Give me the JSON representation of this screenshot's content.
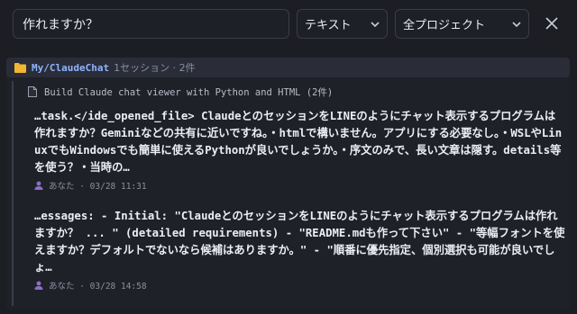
{
  "search": {
    "value": "作れますか？"
  },
  "filters": {
    "type_selected": "テキスト",
    "project_selected": "全プロジェクト"
  },
  "project": {
    "name": "My/ClaudeChat",
    "meta": "1セッション · 2件"
  },
  "session": {
    "title": "Build Claude chat viewer with Python and HTML (2件)"
  },
  "messages": [
    {
      "text": "…task.</ide_opened_file> ClaudeとのセッションをLINEのようにチャット表示するプログラムは作れますか？Geminiなどの共有に近いですね。・htmlで構いません。アプリにする必要なし。・WSLやLinuxでもWindowsでも簡単に使えるPythonが良いでしょうか。・序文のみで、長い文章は隠す。details等を使う？・当時の…",
      "meta": "あなた · 03/28 11:31"
    },
    {
      "text": "…essages: - Initial: \"ClaudeとのセッションをLINEのようにチャット表示するプログラムは作れますか？ ... \" (detailed requirements) - \"README.mdも作って下さい\" - \"等幅フォントを使えますか？デフォルトでないなら候補はありますか。\" - \"順番に優先指定、個別選択も可能が良いでしょ…",
      "meta": "あなた · 03/28 14:58"
    }
  ],
  "colors": {
    "background": "#1c1e24",
    "accent": "#8db4ff",
    "folder": "#f2b630",
    "user_icon": "#8b6fc7"
  },
  "icons": {
    "close": "close-icon",
    "chevron": "chevron-down-icon",
    "folder": "folder-icon",
    "document": "document-icon",
    "user": "user-icon"
  }
}
